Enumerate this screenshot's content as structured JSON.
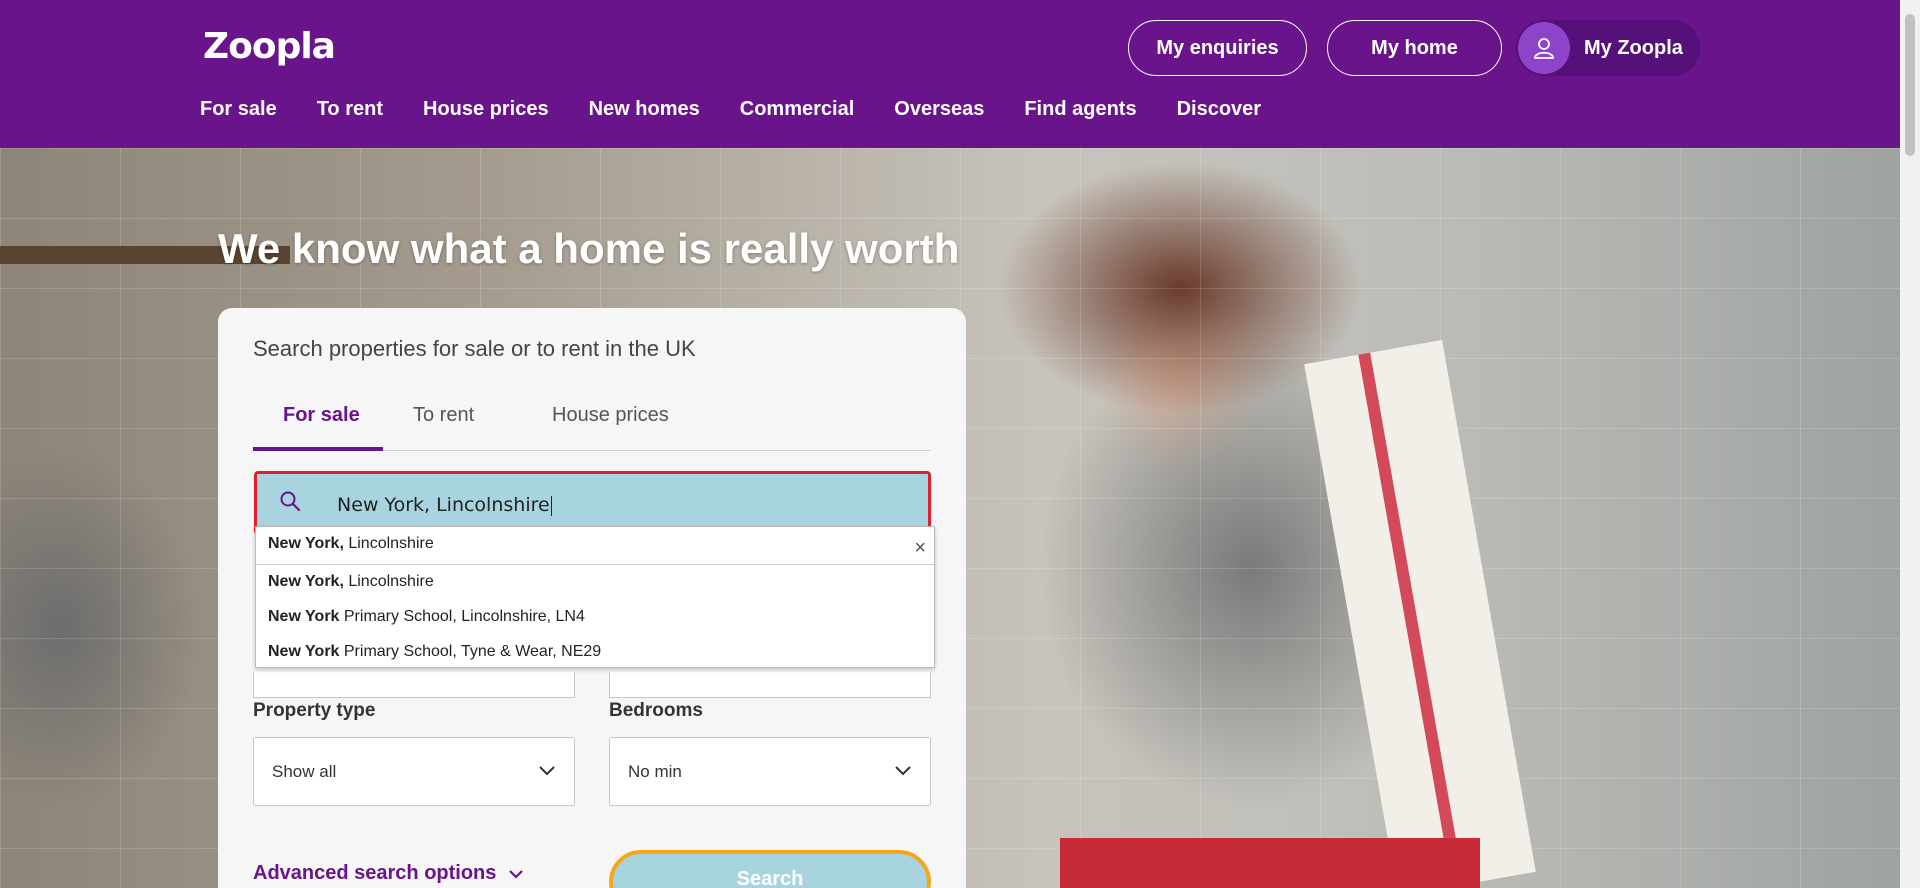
{
  "header": {
    "logo": "Zoopla",
    "buttons": {
      "enquiries": "My enquiries",
      "home": "My home",
      "my_zoopla": "My Zoopla"
    },
    "nav": [
      "For sale",
      "To rent",
      "House prices",
      "New homes",
      "Commercial",
      "Overseas",
      "Find agents",
      "Discover"
    ]
  },
  "hero": {
    "headline": "We know what a home is really worth"
  },
  "search_card": {
    "title": "Search properties for sale or to rent in the UK",
    "tabs": [
      "For sale",
      "To rent",
      "House prices"
    ],
    "active_tab": "For sale",
    "search_value": "New York, Lincolnshire",
    "autocomplete": [
      {
        "bold": "New York,",
        "rest": " Lincolnshire"
      },
      {
        "bold": "New York,",
        "rest": " Lincolnshire"
      },
      {
        "bold": "New York",
        "rest": " Primary School, Lincolnshire, LN4"
      },
      {
        "bold": "New York",
        "rest": " Primary School, Tyne & Wear, NE29"
      }
    ],
    "close_glyph": "×",
    "property_type": {
      "label": "Property type",
      "value": "Show all"
    },
    "bedrooms": {
      "label": "Bedrooms",
      "value": "No min"
    },
    "advanced": "Advanced search options",
    "search_button": "Search"
  },
  "colors": {
    "brand_purple": "#6a148c",
    "search_highlight": "#a8d4e0",
    "error_border": "#e0202a",
    "button_outline": "#f2a81d"
  }
}
